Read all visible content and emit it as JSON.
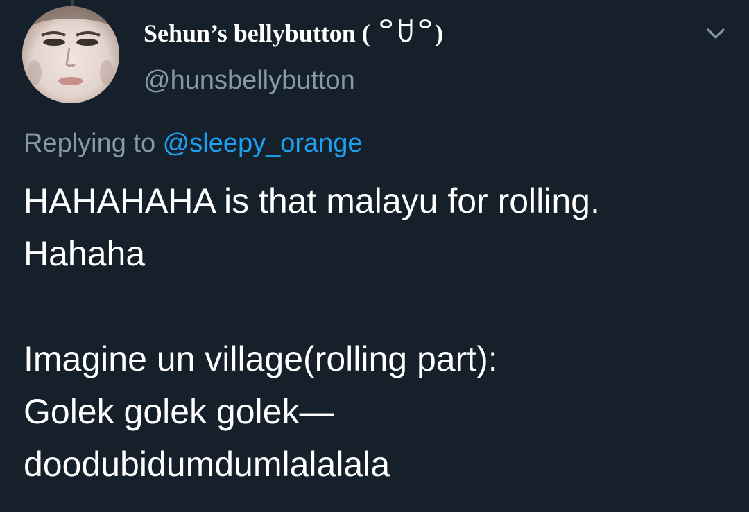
{
  "tweet": {
    "display_name": "Sehun’s bellybutton ( ꒪ꇴ꒪)",
    "handle": "@hunsbellybutton",
    "replying_prefix": "Replying to ",
    "replying_to": "@sleepy_orange",
    "text_lines": [
      "HAHAHAHA is that malayu for rolling.",
      "Hahaha",
      "",
      "Imagine un village(rolling part):",
      "Golek golek golek—",
      "doodubidumdumlalalala"
    ]
  },
  "icons": {
    "menu": "chevron-down-icon",
    "avatar": "profile-photo"
  },
  "colors": {
    "background": "#15202b",
    "text": "#ffffff",
    "secondary_text": "#8899a6",
    "link": "#1da1f2"
  }
}
